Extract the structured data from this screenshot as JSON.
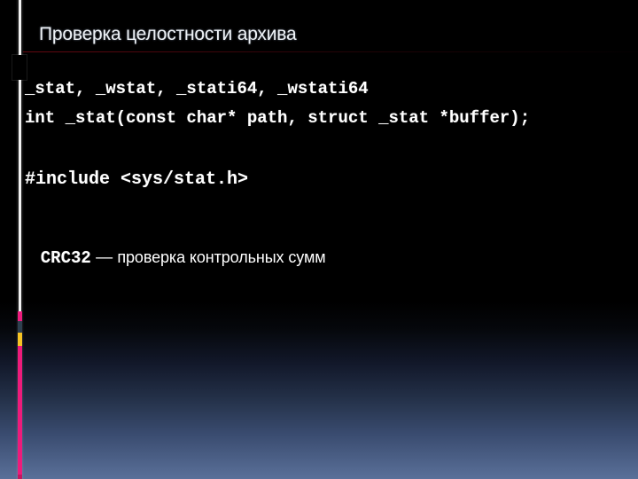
{
  "slide": {
    "title": "Проверка целостности архива",
    "body": {
      "code_line_1": "_stat, _wstat, _stati64, _wstati64",
      "code_line_2": "int _stat(const char* path, struct _stat *buffer);",
      "code_line_3": "#include <sys/stat.h>",
      "crc_label": "CRC32",
      "crc_dash": " — ",
      "crc_description": "проверка контрольных сумм"
    }
  },
  "theme": {
    "background_top": "#000000",
    "background_bottom": "#5a7099",
    "title_color": "#eef2f6",
    "text_color": "#ffffff",
    "rail_color": "#f2f2f2",
    "accent_pink": "#ed1b7b",
    "accent_yellow": "#f6c324",
    "accent_slate": "#2e4050",
    "rule_color": "#780a14"
  }
}
